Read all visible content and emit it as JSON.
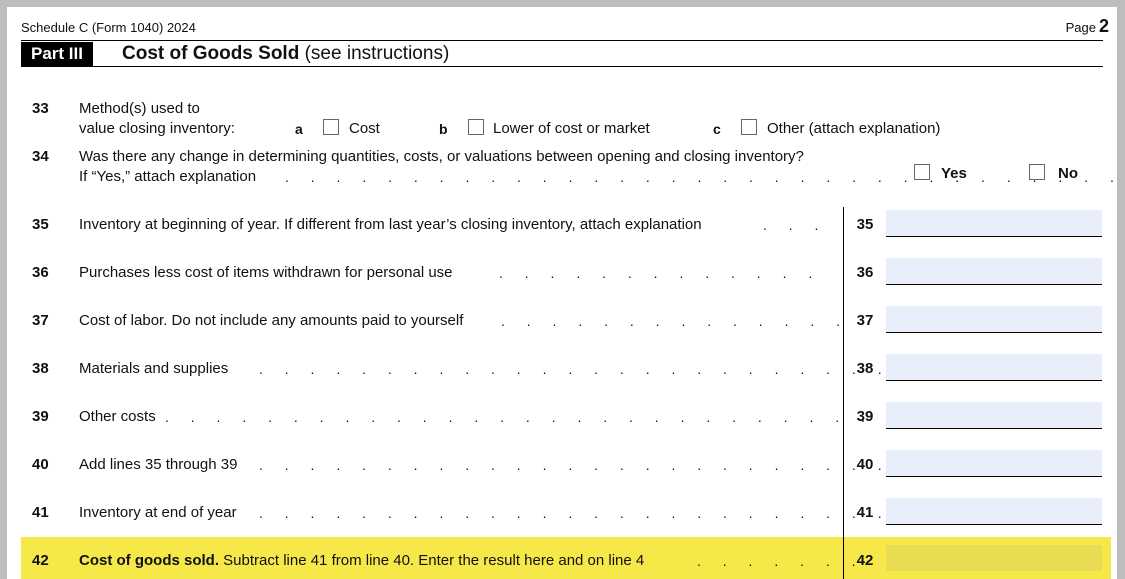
{
  "header": {
    "form_id": "Schedule C (Form 1040) 2024",
    "page_label": "Page",
    "page_number": "2"
  },
  "part": {
    "label": "Part III",
    "title_bold": "Cost of Goods Sold",
    "title_rest": " (see instructions)"
  },
  "line33": {
    "num": "33",
    "text1": "Method(s) used to",
    "text2": "value closing inventory:",
    "options": [
      {
        "letter": "a",
        "label": "Cost"
      },
      {
        "letter": "b",
        "label": "Lower of cost or market"
      },
      {
        "letter": "c",
        "label": "Other (attach explanation)"
      }
    ]
  },
  "line34": {
    "num": "34",
    "text1": "Was there any change in determining quantities, costs, or valuations between opening and closing inventory?",
    "text2": "If “Yes,” attach explanation",
    "yes_label": "Yes",
    "no_label": "No"
  },
  "lines": [
    {
      "num": "35",
      "text": "Inventory at beginning of year. If different from last year’s closing inventory, attach explanation",
      "dots": ". . .",
      "box": "35",
      "value": ""
    },
    {
      "num": "36",
      "text": "Purchases less cost of items withdrawn for personal use",
      "dots": ". . . . . . . . . . . . .",
      "box": "36",
      "value": ""
    },
    {
      "num": "37",
      "text": "Cost of labor. Do not include any amounts paid to yourself",
      "dots": ". . . . . . . . . . . . . .",
      "box": "37",
      "value": ""
    },
    {
      "num": "38",
      "text": "Materials and supplies",
      "dots": ". . . . . . . . . . . . . . . . . . . . . . . . . . .",
      "box": "38",
      "value": ""
    },
    {
      "num": "39",
      "text": "Other costs",
      "dots": ". . . . . . . . . . . . . . . . . . . . . . . . . . . . . . .",
      "box": "39",
      "value": ""
    },
    {
      "num": "40",
      "text": "Add lines 35 through 39",
      "dots": ". . . . . . . . . . . . . . . . . . . . . . . . . .",
      "box": "40",
      "value": ""
    },
    {
      "num": "41",
      "text": "Inventory at end of year",
      "dots": ". . . . . . . . . . . . . . . . . . . . . . . . . .",
      "box": "41",
      "value": ""
    }
  ],
  "line42": {
    "num": "42",
    "text_bold": "Cost of goods sold.",
    "text_rest": " Subtract line 41 from line 40. Enter the result here and on line 4",
    "dots": ". . . . . . .",
    "box": "42",
    "value": ""
  },
  "colors": {
    "highlight": "#f7e84a",
    "field": "#e9eefb",
    "part_bg": "#000000"
  }
}
